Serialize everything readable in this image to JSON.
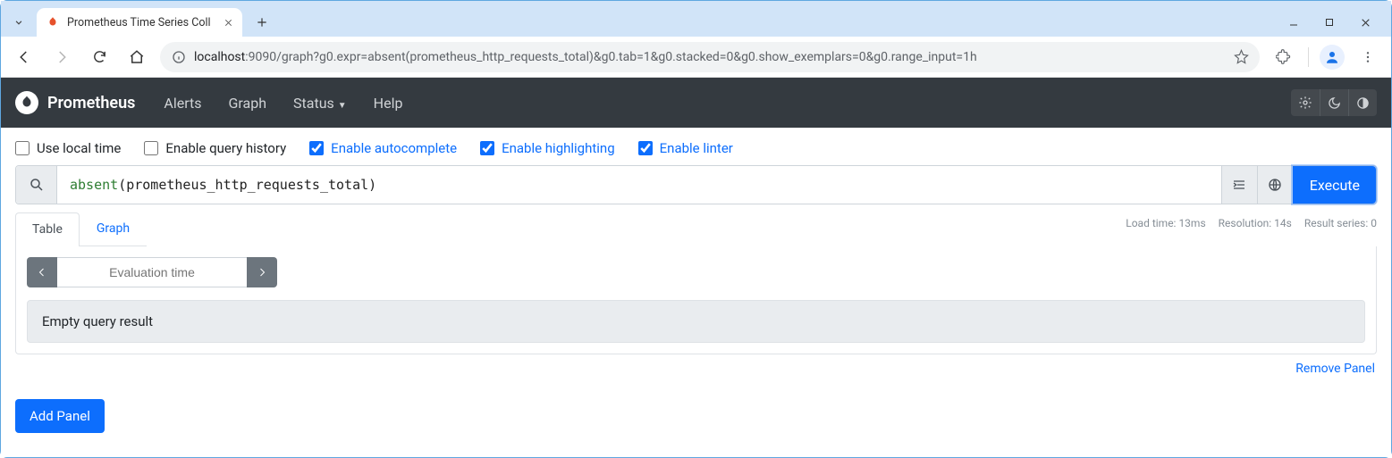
{
  "browser": {
    "tab_title": "Prometheus Time Series Coll",
    "url_host": "localhost",
    "url_port": ":9090",
    "url_path": "/graph?g0.expr=absent(prometheus_http_requests_total)&g0.tab=1&g0.stacked=0&g0.show_exemplars=0&g0.range_input=1h"
  },
  "nav": {
    "brand": "Prometheus",
    "links": {
      "alerts": "Alerts",
      "graph": "Graph",
      "status": "Status",
      "help": "Help"
    }
  },
  "options": {
    "local_time": {
      "label": "Use local time",
      "checked": false
    },
    "history": {
      "label": "Enable query history",
      "checked": false
    },
    "autocomplete": {
      "label": "Enable autocomplete",
      "checked": true
    },
    "highlighting": {
      "label": "Enable highlighting",
      "checked": true
    },
    "linter": {
      "label": "Enable linter",
      "checked": true
    }
  },
  "query": {
    "func": "absent",
    "open": "(",
    "ident": "prometheus_http_requests_total",
    "close": ")",
    "execute_label": "Execute"
  },
  "tabs": {
    "table": "Table",
    "graph": "Graph"
  },
  "stats": {
    "load_time": "Load time: 13ms",
    "resolution": "Resolution: 14s",
    "result_series": "Result series: 0"
  },
  "eval": {
    "placeholder": "Evaluation time"
  },
  "result_text": "Empty query result",
  "links": {
    "remove_panel": "Remove Panel",
    "add_panel": "Add Panel"
  }
}
